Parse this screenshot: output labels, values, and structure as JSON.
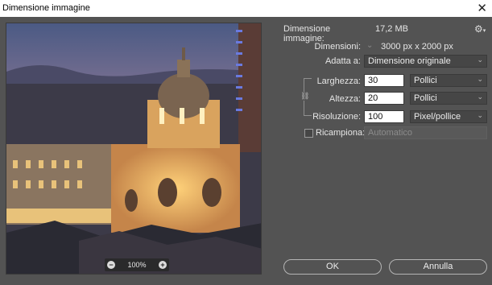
{
  "window": {
    "title": "Dimensione immagine"
  },
  "preview": {
    "zoom": "100%"
  },
  "info": {
    "image_size_label": "Dimensione immagine:",
    "image_size_value": "17,2 MB",
    "dimensions_label": "Dimensioni:",
    "dimensions_value": "3000 px x 2000 px"
  },
  "fit": {
    "label": "Adatta a:",
    "value": "Dimensione originale"
  },
  "width": {
    "label": "Larghezza:",
    "value": "30",
    "unit": "Pollici"
  },
  "height": {
    "label": "Altezza:",
    "value": "20",
    "unit": "Pollici"
  },
  "resolution": {
    "label": "Risoluzione:",
    "value": "100",
    "unit": "Pixel/pollice"
  },
  "resample": {
    "label": "Ricampiona:",
    "checked": false,
    "value": "Automatico"
  },
  "buttons": {
    "ok": "OK",
    "cancel": "Annulla"
  }
}
